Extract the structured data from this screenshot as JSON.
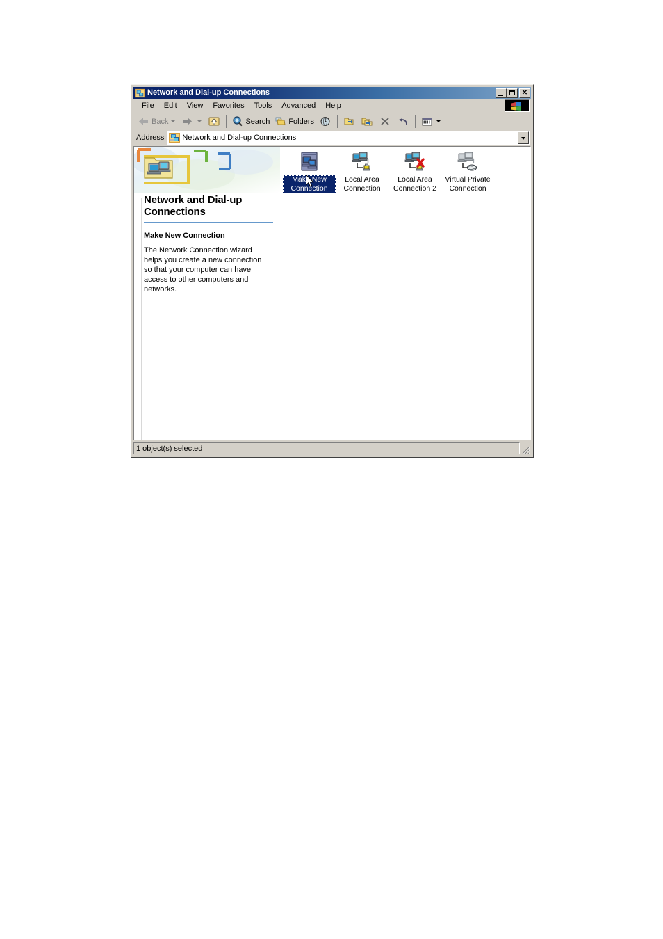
{
  "window": {
    "title": "Network and Dial-up Connections",
    "title_icon": "network-connections-icon",
    "controls": {
      "minimize": "minimize-button",
      "maximize": "maximize-button",
      "close": "close-button",
      "close_glyph": "✕"
    }
  },
  "menu": {
    "items": [
      {
        "label": "File"
      },
      {
        "label": "Edit"
      },
      {
        "label": "View"
      },
      {
        "label": "Favorites"
      },
      {
        "label": "Tools"
      },
      {
        "label": "Advanced"
      },
      {
        "label": "Help"
      }
    ],
    "brand_logo": "windows-logo-icon"
  },
  "toolbar": {
    "back_label": "Back",
    "back_icon": "back-arrow-icon",
    "forward_icon": "forward-arrow-icon",
    "up_icon": "up-one-level-icon",
    "search_label": "Search",
    "search_icon": "search-icon",
    "folders_label": "Folders",
    "folders_icon": "folders-icon",
    "history_icon": "history-globe-icon",
    "moveto_icon": "move-to-icon",
    "copyto_icon": "copy-to-icon",
    "delete_icon": "delete-x-icon",
    "undo_icon": "undo-icon",
    "views_icon": "views-icon"
  },
  "address": {
    "label": "Address",
    "icon": "network-connections-icon",
    "value": "Network and Dial-up Connections",
    "dropdown_icon": "chevron-down-icon"
  },
  "info_pane": {
    "banner_icon": "network-folder-icon",
    "title": "Network and Dial-up Connections",
    "subtitle": "Make New Connection",
    "description": "The Network Connection wizard helps you create a new connection so that your computer can have access to other computers and networks.",
    "divider_color": "#6699cc"
  },
  "connections": [
    {
      "label": "Make New Connection",
      "icon": "make-new-connection-icon",
      "selected": true,
      "name": "make-new-connection"
    },
    {
      "label": "Local Area Connection",
      "icon": "lan-connection-icon",
      "selected": false,
      "name": "local-area-connection"
    },
    {
      "label": "Local Area Connection 2",
      "icon": "lan-connection-disconnected-icon",
      "selected": false,
      "name": "local-area-connection-2"
    },
    {
      "label": "Virtual Private Connection",
      "icon": "vpn-connection-icon",
      "selected": false,
      "name": "virtual-private-connection"
    }
  ],
  "status": {
    "text": "1 object(s) selected",
    "grip": "resize-grip"
  },
  "colors": {
    "titlebar_start": "#0a246a",
    "titlebar_end": "#7da3c8",
    "chrome": "#d4d0c8",
    "selection": "#0a246a",
    "accent_rule": "#6699cc"
  }
}
